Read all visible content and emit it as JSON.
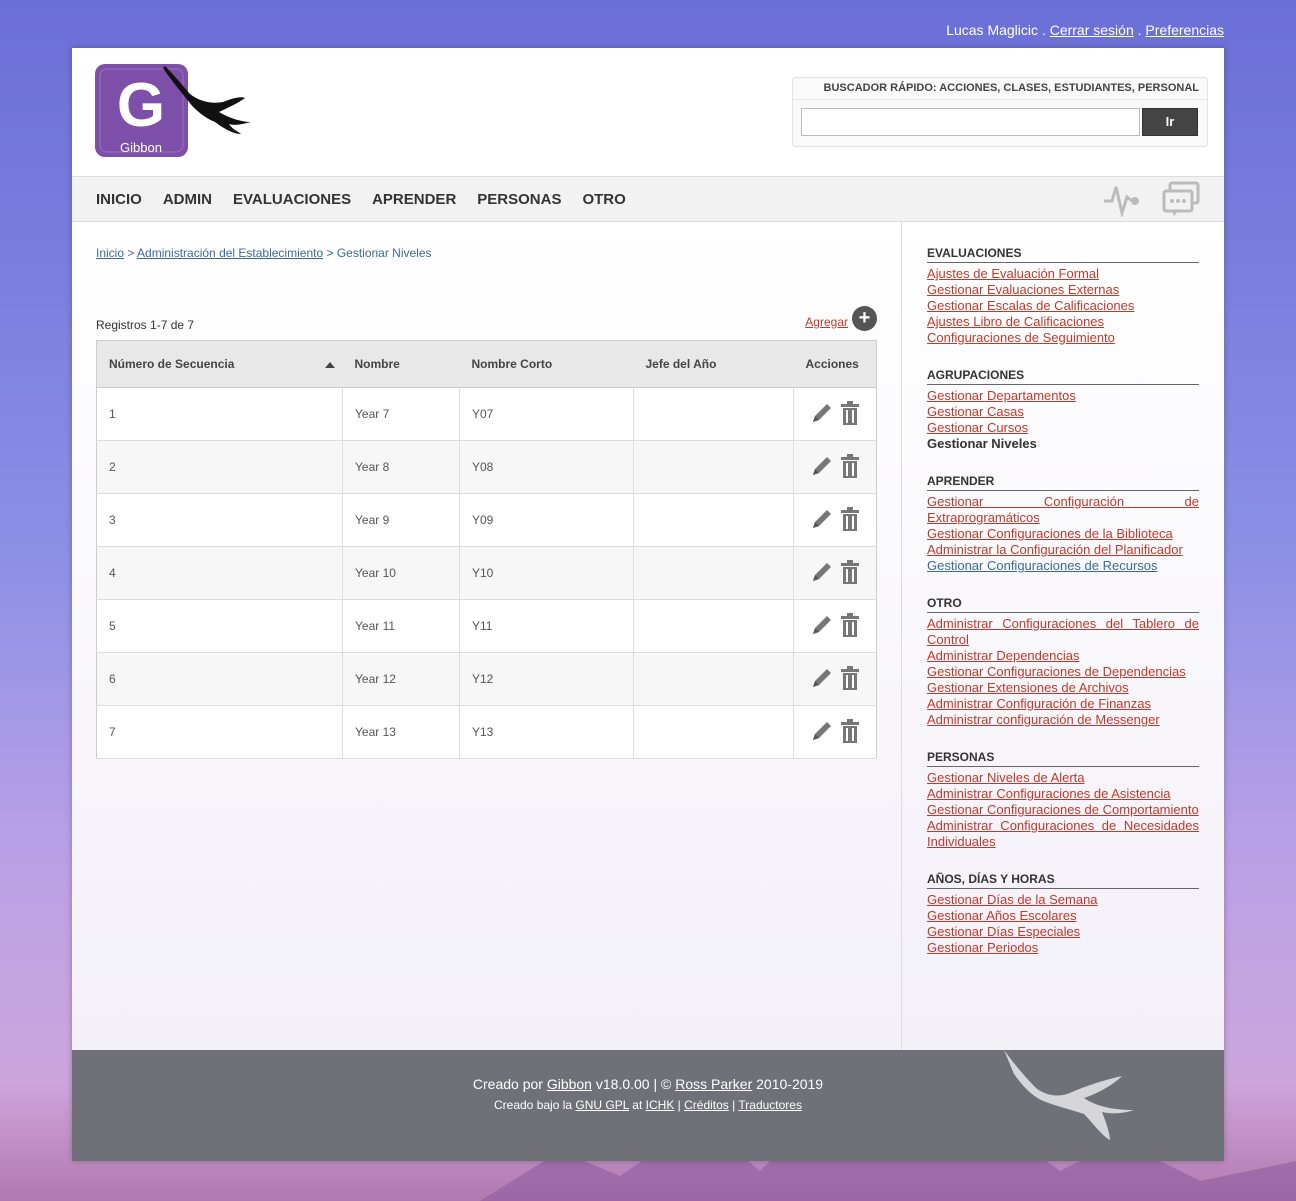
{
  "topbar": {
    "user": "Lucas Maglicic",
    "sep1": " . ",
    "logout": "Cerrar sesión",
    "sep2": " . ",
    "prefs": "Preferencias"
  },
  "logo": {
    "letter": "G",
    "name": "Gibbon"
  },
  "search": {
    "label": "BUSCADOR RÁPIDO: ACCIONES, CLASES, ESTUDIANTES, PERSONAL",
    "value": "",
    "button": "Ir"
  },
  "nav": {
    "items": [
      "INICIO",
      "ADMIN",
      "EVALUACIONES",
      "APRENDER",
      "PERSONAS",
      "OTRO"
    ]
  },
  "breadcrumb": {
    "home": "Inicio",
    "sep": " > ",
    "parent": "Administración del Establecimiento",
    "current": "Gestionar Niveles"
  },
  "records": "Registros 1-7 de 7",
  "add_label": "Agregar",
  "table": {
    "headers": [
      "Número de Secuencia",
      "Nombre",
      "Nombre Corto",
      "Jefe del Año",
      "Acciones"
    ],
    "rows": [
      [
        "1",
        "Year 7",
        "Y07",
        ""
      ],
      [
        "2",
        "Year 8",
        "Y08",
        ""
      ],
      [
        "3",
        "Year 9",
        "Y09",
        ""
      ],
      [
        "4",
        "Year 10",
        "Y10",
        ""
      ],
      [
        "5",
        "Year 11",
        "Y11",
        ""
      ],
      [
        "6",
        "Year 12",
        "Y12",
        ""
      ],
      [
        "7",
        "Year 13",
        "Y13",
        ""
      ]
    ]
  },
  "sidebar": {
    "sections": [
      {
        "title": "EVALUACIONES",
        "links": [
          "Ajustes de Evaluación Formal",
          "Gestionar Evaluaciones Externas",
          "Gestionar Escalas de Calificaciones",
          "Ajustes Libro de Calificaciones",
          "Configuraciones de Seguimiento"
        ]
      },
      {
        "title": "AGRUPACIONES",
        "links": [
          "Gestionar Departamentos",
          "Gestionar Casas",
          "Gestionar Cursos",
          "Gestionar Niveles"
        ]
      },
      {
        "title": "APRENDER",
        "links": [
          "Gestionar Configuración de Extraprogramáticos",
          "Gestionar Configuraciones de la Biblioteca",
          "Administrar la Configuración del Planificador",
          "Gestionar Configuraciones de Recursos"
        ]
      },
      {
        "title": "OTRO",
        "links": [
          "Administrar Configuraciones del Tablero de Control",
          "Administrar Dependencias",
          "Gestionar Configuraciones de Dependencias",
          "Gestionar Extensiones de Archivos",
          "Administrar Configuración de Finanzas",
          "Administrar configuración de Messenger"
        ]
      },
      {
        "title": "PERSONAS",
        "links": [
          "Gestionar Niveles de Alerta",
          "Administrar Configuraciones de Asistencia",
          "Gestionar Configuraciones de Comportamiento",
          "Administrar Configuraciones de Necesidades Individuales"
        ]
      },
      {
        "title": "AÑOS, DÍAS Y HORAS",
        "links": [
          "Gestionar Días de la Semana",
          "Gestionar Años Escolares",
          "Gestionar Días Especiales",
          "Gestionar Periodos"
        ]
      }
    ]
  },
  "footer": {
    "created_by": "Creado por ",
    "gibbon": "Gibbon",
    "version": " v18.0.00 | © ",
    "author": "Ross Parker",
    "years": " 2010-2019",
    "license_pre": "Creado bajo la ",
    "license": "GNU GPL",
    "at": " at ",
    "ichk": "ICHK",
    "bar1": " | ",
    "credits": "Créditos",
    "bar2": " | ",
    "translators": "Traductores"
  },
  "colors": {
    "link": "#c0392b",
    "link_blue": "#3b6a9a",
    "logo_purple": "#7d4fa8",
    "nav_bg": "#f2f2f2"
  }
}
